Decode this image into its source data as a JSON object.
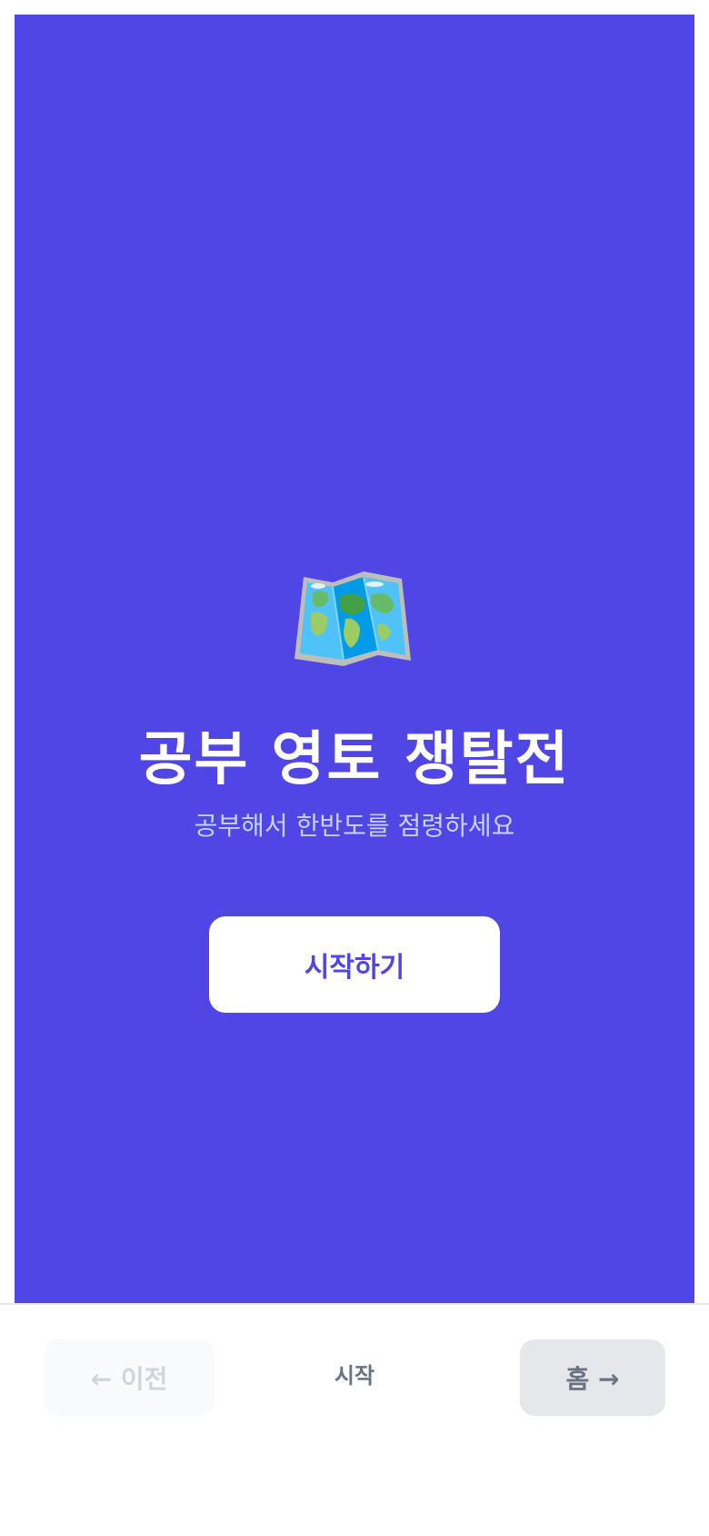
{
  "hero": {
    "icon": "world-map-icon",
    "title": "공부 영토 쟁탈전",
    "subtitle": "공부해서 한반도를 점령하세요",
    "start_label": "시작하기",
    "background_color": "#4f46e5"
  },
  "footer": {
    "prev_label": "← 이전",
    "step_label": "시작",
    "home_label": "홈 →"
  }
}
